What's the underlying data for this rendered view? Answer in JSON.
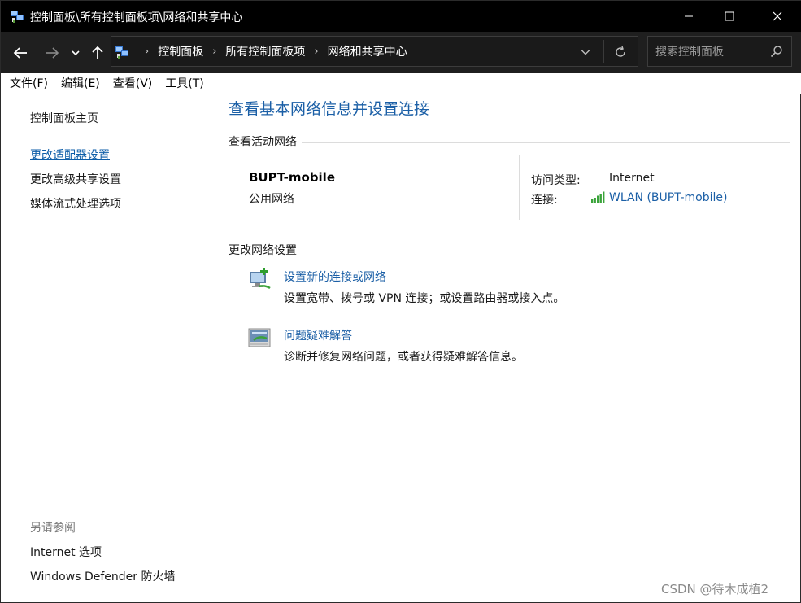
{
  "window": {
    "title": "控制面板\\所有控制面板项\\网络和共享中心"
  },
  "address_bar": {
    "breadcrumbs": [
      "控制面板",
      "所有控制面板项",
      "网络和共享中心"
    ],
    "separator": "›"
  },
  "search": {
    "placeholder": "搜索控制面板"
  },
  "menu": [
    "文件(F)",
    "编辑(E)",
    "查看(V)",
    "工具(T)"
  ],
  "sidebar": {
    "home": "控制面板主页",
    "links": [
      {
        "label": "更改适配器设置",
        "active": true
      },
      {
        "label": "更改高级共享设置",
        "active": false
      },
      {
        "label": "媒体流式处理选项",
        "active": false
      }
    ],
    "see_also_title": "另请参阅",
    "see_also": [
      "Internet 选项",
      "Windows Defender 防火墙"
    ]
  },
  "main": {
    "title": "查看基本网络信息并设置连接",
    "active_networks_title": "查看活动网络",
    "network": {
      "name": "BUPT-mobile",
      "category": "公用网络",
      "access_type_label": "访问类型:",
      "access_type_value": "Internet",
      "connections_label": "连接:",
      "connection_link": "WLAN (BUPT-mobile)"
    },
    "change_settings_title": "更改网络设置",
    "tasks": [
      {
        "link": "设置新的连接或网络",
        "desc": "设置宽带、拨号或 VPN 连接；或设置路由器或接入点。",
        "icon": "new-connection-icon"
      },
      {
        "link": "问题疑难解答",
        "desc": "诊断并修复网络问题，或者获得疑难解答信息。",
        "icon": "troubleshoot-icon"
      }
    ]
  },
  "watermark": "CSDN @待木成植2",
  "colors": {
    "link": "#1b5fa6",
    "titlebar": "#000000",
    "navbar": "#1f1f1f"
  }
}
